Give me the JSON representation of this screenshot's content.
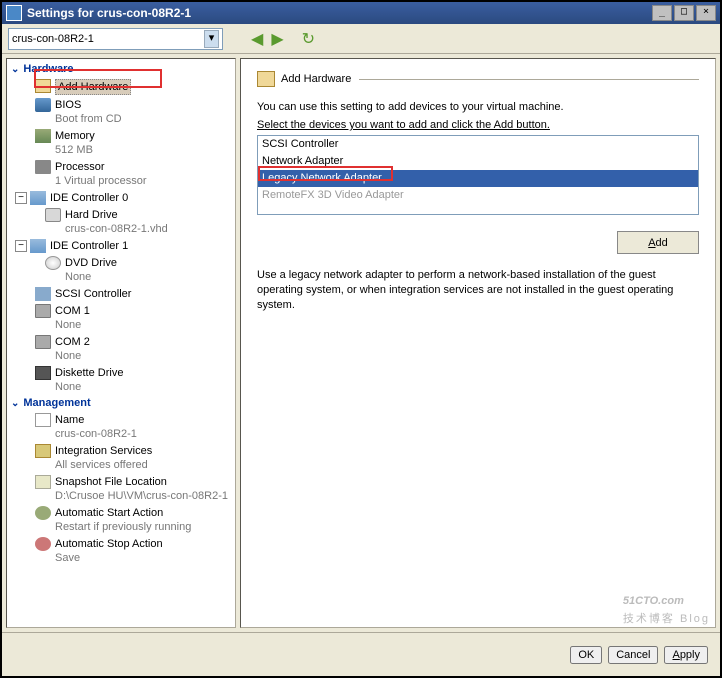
{
  "window": {
    "title": "Settings for crus-con-08R2-1",
    "vm_name": "crus-con-08R2-1"
  },
  "tree": {
    "hardware_section": "Hardware",
    "add_hardware": "Add Hardware",
    "bios": {
      "label": "BIOS",
      "sub": "Boot from CD"
    },
    "memory": {
      "label": "Memory",
      "sub": "512 MB"
    },
    "processor": {
      "label": "Processor",
      "sub": "1 Virtual processor"
    },
    "ide0": {
      "label": "IDE Controller 0"
    },
    "hdd": {
      "label": "Hard Drive",
      "sub": "crus-con-08R2-1.vhd"
    },
    "ide1": {
      "label": "IDE Controller 1"
    },
    "dvd": {
      "label": "DVD Drive",
      "sub": "None"
    },
    "scsi": {
      "label": "SCSI Controller"
    },
    "com1": {
      "label": "COM 1",
      "sub": "None"
    },
    "com2": {
      "label": "COM 2",
      "sub": "None"
    },
    "diskette": {
      "label": "Diskette Drive",
      "sub": "None"
    },
    "management_section": "Management",
    "name": {
      "label": "Name",
      "sub": "crus-con-08R2-1"
    },
    "integration": {
      "label": "Integration Services",
      "sub": "All services offered"
    },
    "snapshot": {
      "label": "Snapshot File Location",
      "sub": "D:\\Crusoe HU\\VM\\crus-con-08R2-1"
    },
    "autostart": {
      "label": "Automatic Start Action",
      "sub": "Restart if previously running"
    },
    "autostop": {
      "label": "Automatic Stop Action",
      "sub": "Save"
    }
  },
  "right": {
    "title": "Add Hardware",
    "intro": "You can use this setting to add devices to your virtual machine.",
    "instruct": "Select the devices you want to add and click the Add button.",
    "devices": [
      {
        "label": "SCSI Controller",
        "state": "normal"
      },
      {
        "label": "Network Adapter",
        "state": "normal"
      },
      {
        "label": "Legacy Network Adapter",
        "state": "selected"
      },
      {
        "label": "RemoteFX 3D Video Adapter",
        "state": "disabled"
      }
    ],
    "add_btn": "Add",
    "desc": "Use a legacy network adapter to perform a network-based installation of the guest operating system, or when integration services are not installed in the guest operating system."
  },
  "buttons": {
    "ok": "OK",
    "cancel": "Cancel",
    "apply": "Apply"
  },
  "watermark": {
    "big": "51CTO.com",
    "small": "技术博客  Blog"
  }
}
